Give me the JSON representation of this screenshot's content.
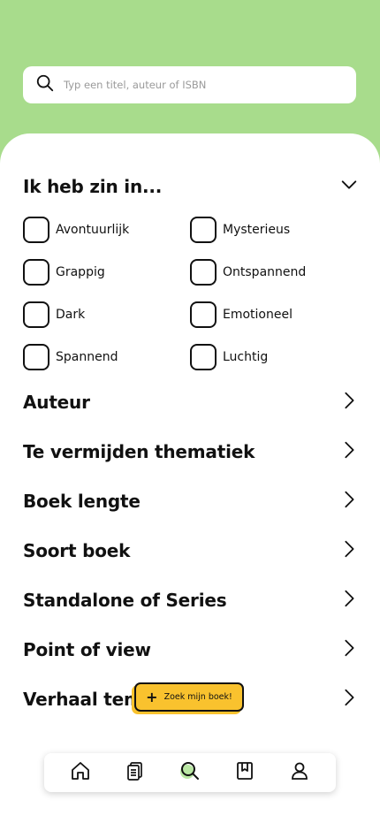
{
  "search": {
    "placeholder": "Typ een titel, auteur of ISBN",
    "icon": "search-icon"
  },
  "mood": {
    "title": "Ik heb zin in...",
    "expanded": true,
    "options": [
      {
        "label": "Avontuurlijk",
        "checked": false
      },
      {
        "label": "Mysterieus",
        "checked": false
      },
      {
        "label": "Grappig",
        "checked": false
      },
      {
        "label": "Ontspannend",
        "checked": false
      },
      {
        "label": "Dark",
        "checked": false
      },
      {
        "label": "Emotioneel",
        "checked": false
      },
      {
        "label": "Spannend",
        "checked": false
      },
      {
        "label": "Luchtig",
        "checked": false
      }
    ]
  },
  "filters": [
    {
      "label": "Auteur"
    },
    {
      "label": "Te vermijden thematiek"
    },
    {
      "label": "Boek lengte"
    },
    {
      "label": "Soort boek"
    },
    {
      "label": "Standalone of Series"
    },
    {
      "label": "Point of view"
    },
    {
      "label": "Verhaal tempo"
    }
  ],
  "cta": {
    "label": "Zoek mijn boek!",
    "icon": "plus-icon"
  },
  "nav": {
    "items": [
      {
        "name": "home",
        "icon": "home-icon",
        "active": false
      },
      {
        "name": "list",
        "icon": "clipboard-icon",
        "active": false
      },
      {
        "name": "search",
        "icon": "search-icon",
        "active": true
      },
      {
        "name": "bookmarks",
        "icon": "bookmark-icon",
        "active": false
      },
      {
        "name": "profile",
        "icon": "user-icon",
        "active": false
      }
    ]
  },
  "colors": {
    "header_green": "#a8dc8c",
    "accent_yellow": "#f9c22e",
    "active_nav_dot": "#b9e7a3"
  }
}
